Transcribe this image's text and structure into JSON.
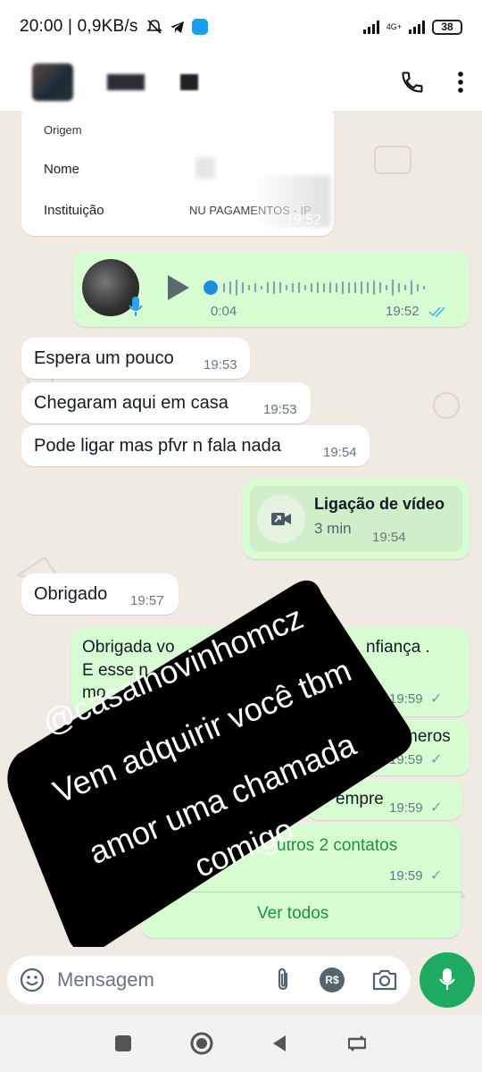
{
  "status": {
    "time_speed": "20:00 | 0,9KB/s",
    "network_tag": "4G+",
    "battery": "38"
  },
  "card": {
    "origem_label": "Origem",
    "nome_label": "Nome",
    "instituicao_label": "Instituição",
    "instituicao_value": "NU PAGAMENTOS - IP",
    "time": "19:52"
  },
  "voice": {
    "duration": "0:04",
    "time": "19:52",
    "status": "read"
  },
  "messages": [
    {
      "text": "Espera um pouco",
      "time": "19:53"
    },
    {
      "text": "Chegaram aqui em casa",
      "time": "19:53"
    },
    {
      "text": "Pode ligar mas pfvr n fala nada",
      "time": "19:54"
    }
  ],
  "video_call": {
    "title": "Ligação de vídeo",
    "duration": "3 min",
    "time": "19:54"
  },
  "obrigado": {
    "text": "Obrigado",
    "time": "19:57"
  },
  "outgoing": [
    {
      "text_a": "Obrigada vo",
      "text_b": "nfiança .",
      "line2": "E esse n",
      "line3": "mo",
      "time": "19:59"
    },
    {
      "text": "meros",
      "time": "19:59"
    },
    {
      "text": "empre",
      "time": "19:59"
    },
    {
      "contacts": "utros 2 contatos",
      "time": "19:59",
      "button": "Ver todos"
    }
  ],
  "sticker": {
    "line1": "@casalnovinhomcz",
    "line2": "Vem adquirir você tbm",
    "line3": "amor uma chamada",
    "line4": "comigo"
  },
  "input": {
    "placeholder": "Mensagem",
    "currency_icon_label": "R$"
  },
  "colors": {
    "outgoing_bubble": "#d9fdd3",
    "incoming_bubble": "#ffffff",
    "chat_bg": "#efeae2",
    "accent_green": "#1daa61",
    "read_ticks": "#53bdeb"
  }
}
